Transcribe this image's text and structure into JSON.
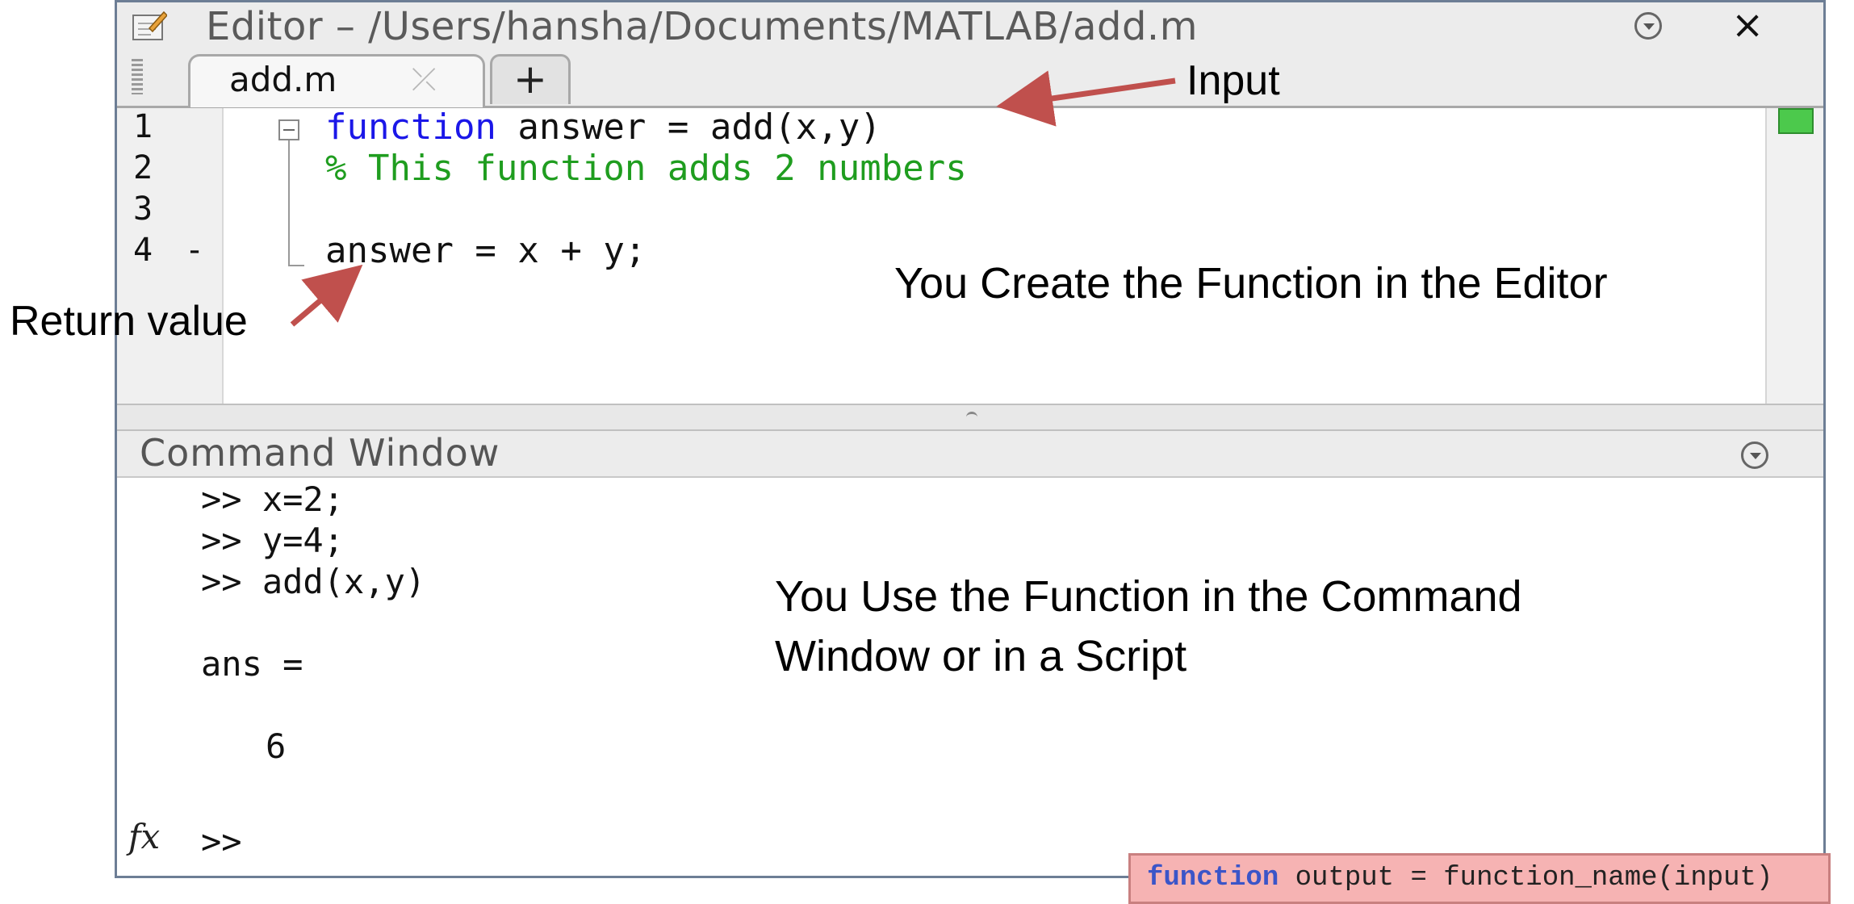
{
  "editor": {
    "title": "Editor – /Users/hansha/Documents/MATLAB/add.m",
    "tab_label": "add.m",
    "tab_close": "⤫",
    "tab_add": "+",
    "close": "×",
    "lines": [
      {
        "number": "1",
        "keyword": "function",
        "rest": " answer = add(x,y)"
      },
      {
        "number": "2",
        "comment": "% This function adds 2 numbers"
      },
      {
        "number": "3",
        "text": ""
      },
      {
        "number": "4",
        "marker": "-",
        "text": "answer = x + y;"
      }
    ]
  },
  "command_window": {
    "title": "Command Window",
    "lines": [
      ">> x=2;",
      ">> y=4;",
      ">> add(x,y)",
      "ans =",
      "6"
    ],
    "prompt": ">>",
    "fx": "fx"
  },
  "annotations": {
    "input": "Input",
    "return_value": "Return value",
    "create": "You Create the Function in the Editor",
    "use_line1": "You Use the Function in the Command",
    "use_line2": "Window or in a Script"
  },
  "syntax": {
    "keyword": "function",
    "rest": " output = function_name(input)"
  },
  "colors": {
    "keyword": "#1b17e8",
    "comment": "#1f9d1f",
    "arrow": "#c0504d",
    "status_ok": "#4cc94c"
  }
}
